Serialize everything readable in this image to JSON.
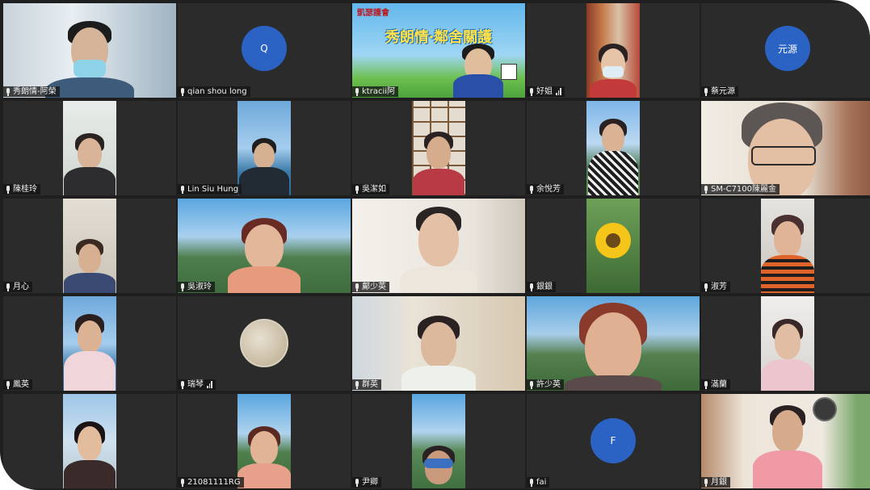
{
  "banner": {
    "logo_text": "凱瑟護會",
    "headline": "秀朗情‧鄰舍關護"
  },
  "tiles": [
    {
      "name": "秀朗情-阿榮",
      "signal": false
    },
    {
      "name": "qian shou long",
      "signal": false,
      "avatar_letter": "Q"
    },
    {
      "name": "ktracii阿",
      "signal": false
    },
    {
      "name": "好姐",
      "signal": true
    },
    {
      "name": "蔡元源",
      "signal": false,
      "avatar_letter": "元源"
    },
    {
      "name": "陳桂玲",
      "signal": false
    },
    {
      "name": "Lin Siu Hung",
      "signal": false
    },
    {
      "name": "吳潔如",
      "signal": false
    },
    {
      "name": "余悅芳",
      "signal": false
    },
    {
      "name": "SM-C7100陳麗金",
      "signal": false
    },
    {
      "name": "月心",
      "signal": false
    },
    {
      "name": "吳淑玲",
      "signal": false
    },
    {
      "name": "鄺少英",
      "signal": false
    },
    {
      "name": "銀銀",
      "signal": false
    },
    {
      "name": "淑芳",
      "signal": false
    },
    {
      "name": "鳳英",
      "signal": false
    },
    {
      "name": "瑞琴",
      "signal": true
    },
    {
      "name": "群英",
      "signal": false
    },
    {
      "name": "許少英",
      "signal": false
    },
    {
      "name": "滿蘭",
      "signal": false
    },
    {
      "name": "",
      "signal": false
    },
    {
      "name": "21081111RG",
      "signal": false
    },
    {
      "name": "尹卿",
      "signal": false
    },
    {
      "name": "fai",
      "signal": false,
      "avatar_letter": "F"
    },
    {
      "name": "月銀",
      "signal": false
    }
  ],
  "colors": {
    "avatar_blue": "#2a63c4",
    "background": "#1f1f1f"
  }
}
